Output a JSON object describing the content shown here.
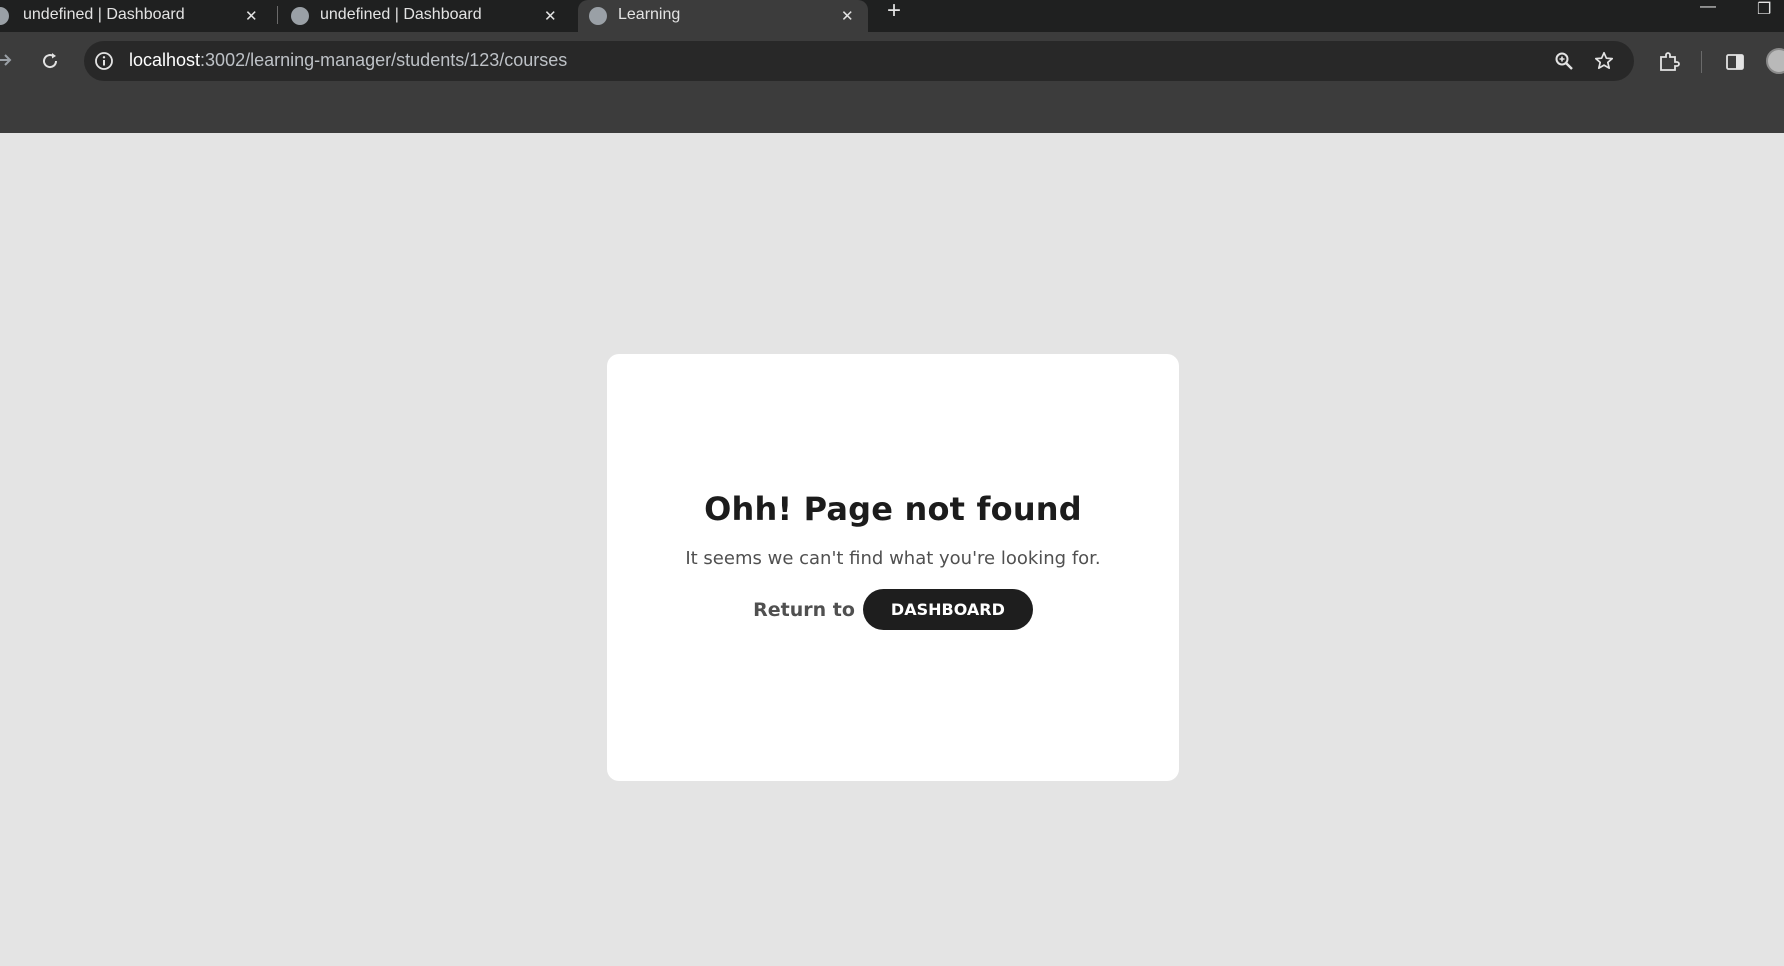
{
  "tabs": [
    {
      "title": "undefined | Dashboard",
      "close": "✕"
    },
    {
      "title": "undefined | Dashboard",
      "close": "✕"
    },
    {
      "title": "Learning",
      "close": "✕",
      "active": true
    }
  ],
  "new_tab_label": "+",
  "window_controls": {
    "minimize": "—",
    "restore": "❐"
  },
  "address_bar": {
    "host": "localhost",
    "path": ":3002/learning-manager/students/123/courses"
  },
  "icons": {
    "back": "arrow-right-icon",
    "reload": "reload-icon",
    "info": "info-icon",
    "zoom": "zoom-icon",
    "bookmark": "star-icon",
    "extensions": "puzzle-icon",
    "sidepanel": "sidepanel-icon",
    "profile": "avatar"
  },
  "colors": {
    "page_bg": "#e4e4e4",
    "card_bg": "#ffffff",
    "button_bg": "#1e1e1e",
    "chrome_dark": "#1f2020",
    "toolbar": "#3c3c3c"
  },
  "error": {
    "title": "Ohh! Page not found",
    "message": "It seems we can't find what you're looking for.",
    "return_label": "Return to",
    "button_label": "DASHBOARD"
  }
}
